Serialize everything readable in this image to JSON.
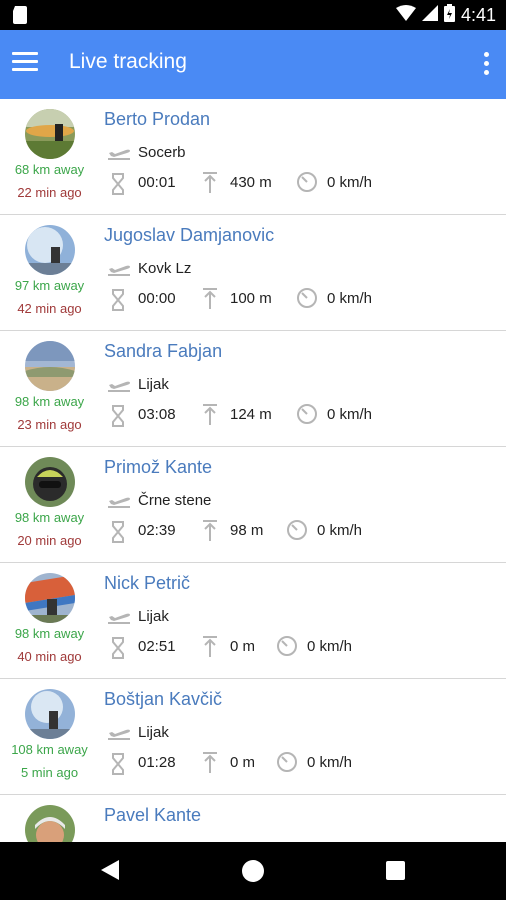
{
  "status_bar": {
    "time": "4:41"
  },
  "app_bar": {
    "title": "Live tracking"
  },
  "pilots": [
    {
      "name": "Berto Prodan",
      "distance": "68 km away",
      "ago": "22 min ago",
      "site": "Socerb",
      "time": "00:01",
      "altitude": "430 m",
      "speed": "0 km/h"
    },
    {
      "name": "Jugoslav Damjanovic",
      "distance": "97 km away",
      "ago": "42 min ago",
      "site": "Kovk Lz",
      "time": "00:00",
      "altitude": "100 m",
      "speed": "0 km/h"
    },
    {
      "name": "Sandra Fabjan",
      "distance": "98 km away",
      "ago": "23 min ago",
      "site": "Lijak",
      "time": "03:08",
      "altitude": "124 m",
      "speed": "0 km/h"
    },
    {
      "name": "Primož Kante",
      "distance": "98 km away",
      "ago": "20 min ago",
      "site": "Črne stene",
      "time": "02:39",
      "altitude": "98 m",
      "speed": "0 km/h"
    },
    {
      "name": "Nick Petrič",
      "distance": "98 km away",
      "ago": "40 min ago",
      "site": "Lijak",
      "time": "02:51",
      "altitude": "0 m",
      "speed": "0 km/h"
    },
    {
      "name": "Boštjan Kavčič",
      "distance": "108 km away",
      "ago": "5 min ago",
      "site": "Lijak",
      "time": "01:28",
      "altitude": "0 m",
      "speed": "0 km/h"
    },
    {
      "name": "Pavel Kante"
    }
  ],
  "icons": {
    "takeoff": "airplane-takeoff-icon",
    "time": "hourglass-icon",
    "altitude": "arrow-up-icon",
    "speed": "speedometer-icon"
  }
}
